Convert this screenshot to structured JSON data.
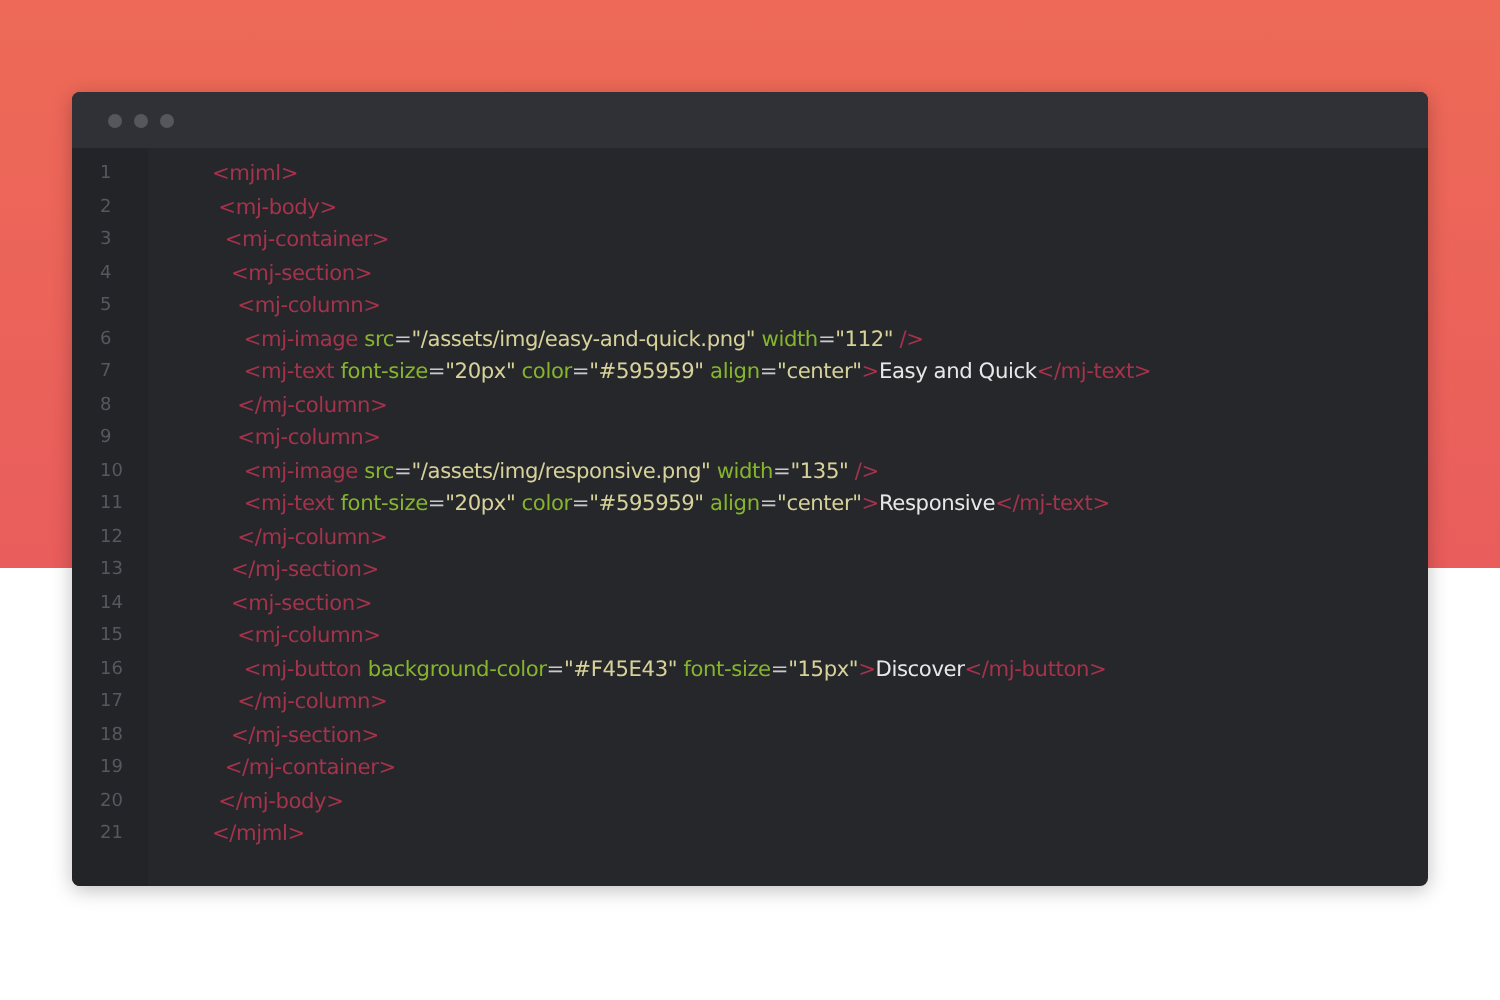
{
  "window": {
    "controls": [
      {
        "kind": "dot"
      },
      {
        "kind": "dot"
      },
      {
        "kind": "dot"
      }
    ]
  },
  "lines": [
    {
      "number": "1",
      "tokens": [
        {
          "kind": "tag",
          "text": "<mjml>"
        }
      ]
    },
    {
      "number": "2",
      "tokens": [
        {
          "kind": "tag",
          "text": " <mj-body>"
        }
      ]
    },
    {
      "number": "3",
      "tokens": [
        {
          "kind": "tag",
          "text": "  <mj-container>"
        }
      ]
    },
    {
      "number": "4",
      "tokens": [
        {
          "kind": "tag",
          "text": "   <mj-section>"
        }
      ]
    },
    {
      "number": "5",
      "tokens": [
        {
          "kind": "tag",
          "text": "    <mj-column>"
        }
      ]
    },
    {
      "number": "6",
      "tokens": [
        {
          "kind": "tag",
          "text": "     <mj-image"
        },
        {
          "kind": "attr",
          "text": " src"
        },
        {
          "kind": "punct",
          "text": "="
        },
        {
          "kind": "string",
          "text": "\"/assets/img/easy-and-quick.png\""
        },
        {
          "kind": "attr",
          "text": " width"
        },
        {
          "kind": "punct",
          "text": "="
        },
        {
          "kind": "string",
          "text": "\"112\""
        },
        {
          "kind": "tag",
          "text": " />"
        }
      ]
    },
    {
      "number": "7",
      "tokens": [
        {
          "kind": "tag",
          "text": "     <mj-text"
        },
        {
          "kind": "attr",
          "text": " font-size"
        },
        {
          "kind": "punct",
          "text": "="
        },
        {
          "kind": "string",
          "text": "\"20px\""
        },
        {
          "kind": "attr",
          "text": " color"
        },
        {
          "kind": "punct",
          "text": "="
        },
        {
          "kind": "string",
          "text": "\"#595959\""
        },
        {
          "kind": "attr",
          "text": " align"
        },
        {
          "kind": "punct",
          "text": "="
        },
        {
          "kind": "string",
          "text": "\"center\""
        },
        {
          "kind": "tag",
          "text": ">"
        },
        {
          "kind": "text",
          "text": "Easy and Quick"
        },
        {
          "kind": "tag",
          "text": "</mj-text>"
        }
      ]
    },
    {
      "number": "8",
      "tokens": [
        {
          "kind": "tag",
          "text": "    </mj-column>"
        }
      ]
    },
    {
      "number": "9",
      "tokens": [
        {
          "kind": "tag",
          "text": "    <mj-column>"
        }
      ]
    },
    {
      "number": "10",
      "tokens": [
        {
          "kind": "tag",
          "text": "     <mj-image"
        },
        {
          "kind": "attr",
          "text": " src"
        },
        {
          "kind": "punct",
          "text": "="
        },
        {
          "kind": "string",
          "text": "\"/assets/img/responsive.png\""
        },
        {
          "kind": "attr",
          "text": " width"
        },
        {
          "kind": "punct",
          "text": "="
        },
        {
          "kind": "string",
          "text": "\"135\""
        },
        {
          "kind": "tag",
          "text": " />"
        }
      ]
    },
    {
      "number": "11",
      "tokens": [
        {
          "kind": "tag",
          "text": "     <mj-text"
        },
        {
          "kind": "attr",
          "text": " font-size"
        },
        {
          "kind": "punct",
          "text": "="
        },
        {
          "kind": "string",
          "text": "\"20px\""
        },
        {
          "kind": "attr",
          "text": " color"
        },
        {
          "kind": "punct",
          "text": "="
        },
        {
          "kind": "string",
          "text": "\"#595959\""
        },
        {
          "kind": "attr",
          "text": " align"
        },
        {
          "kind": "punct",
          "text": "="
        },
        {
          "kind": "string",
          "text": "\"center\""
        },
        {
          "kind": "tag",
          "text": ">"
        },
        {
          "kind": "text",
          "text": "Responsive"
        },
        {
          "kind": "tag",
          "text": "</mj-text>"
        }
      ]
    },
    {
      "number": "12",
      "tokens": [
        {
          "kind": "tag",
          "text": "    </mj-column>"
        }
      ]
    },
    {
      "number": "13",
      "tokens": [
        {
          "kind": "tag",
          "text": "   </mj-section>"
        }
      ]
    },
    {
      "number": "14",
      "tokens": [
        {
          "kind": "tag",
          "text": "   <mj-section>"
        }
      ]
    },
    {
      "number": "15",
      "tokens": [
        {
          "kind": "tag",
          "text": "    <mj-column>"
        }
      ]
    },
    {
      "number": "16",
      "tokens": [
        {
          "kind": "tag",
          "text": "     <mj-button"
        },
        {
          "kind": "attr",
          "text": " background-color"
        },
        {
          "kind": "punct",
          "text": "="
        },
        {
          "kind": "string",
          "text": "\"#F45E43\""
        },
        {
          "kind": "attr",
          "text": " font-size"
        },
        {
          "kind": "punct",
          "text": "="
        },
        {
          "kind": "string",
          "text": "\"15px\""
        },
        {
          "kind": "tag",
          "text": ">"
        },
        {
          "kind": "text",
          "text": "Discover"
        },
        {
          "kind": "tag",
          "text": "</mj-button>"
        }
      ]
    },
    {
      "number": "17",
      "tokens": [
        {
          "kind": "tag",
          "text": "    </mj-column>"
        }
      ]
    },
    {
      "number": "18",
      "tokens": [
        {
          "kind": "tag",
          "text": "   </mj-section>"
        }
      ]
    },
    {
      "number": "19",
      "tokens": [
        {
          "kind": "tag",
          "text": "  </mj-container>"
        }
      ]
    },
    {
      "number": "20",
      "tokens": [
        {
          "kind": "tag",
          "text": " </mj-body>"
        }
      ]
    },
    {
      "number": "21",
      "tokens": [
        {
          "kind": "tag",
          "text": "</mjml>"
        }
      ]
    }
  ]
}
